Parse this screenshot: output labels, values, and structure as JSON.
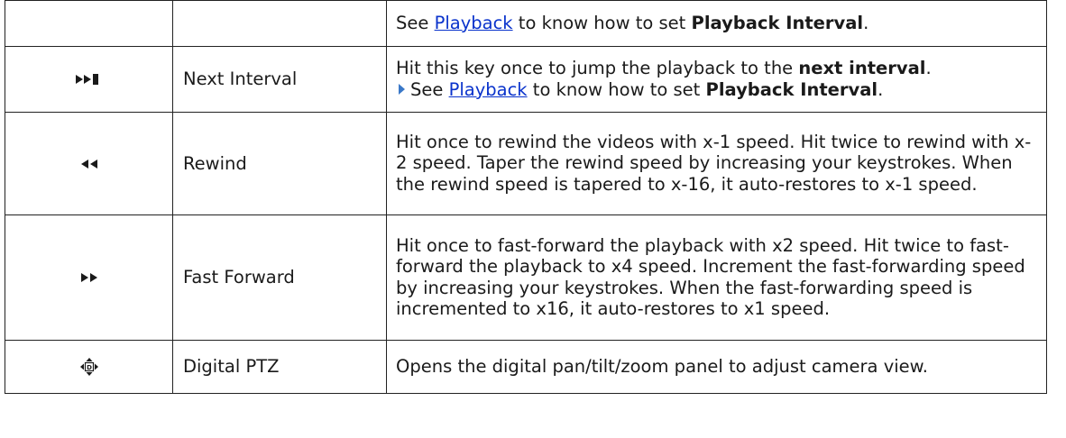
{
  "rows": [
    {
      "icon": "",
      "name": "",
      "desc": {
        "see": "See",
        "link": "Playback",
        "mid": "to know how to set",
        "bold": "Playback Interval",
        "end": "."
      }
    },
    {
      "icon": "next-interval-icon",
      "name": "Next Interval",
      "desc": {
        "line1": "Hit this key once to jump the playback to the",
        "line1_bold": "next interval",
        "line1_end": ".",
        "see": "See",
        "link": "Playback",
        "mid": "to know how to set",
        "bold": "Playback Interval",
        "end": "."
      }
    },
    {
      "icon": "rewind-icon",
      "name": "Rewind",
      "desc": "Hit once to rewind the videos with x-1 speed. Hit twice to rewind with x-2 speed. Taper the rewind speed by increasing your keystrokes. When the rewind speed is tapered to x-16, it auto-restores to x-1 speed."
    },
    {
      "icon": "fast-forward-icon",
      "name": "Fast Forward",
      "desc": "Hit once to fast-forward the playback with x2 speed. Hit twice to fast-forward the playback to x4 speed. Increment the fast-forwarding speed by increasing your keystrokes. When the fast-forwarding speed is incremented to x16, it auto-restores to x1 speed."
    },
    {
      "icon": "digital-ptz-icon",
      "name": "Digital PTZ",
      "desc": "Opens the digital pan/tilt/zoom panel to adjust camera view."
    }
  ],
  "colors": {
    "link": "#0a33cc",
    "border": "#222222",
    "arrow": "#3a78c8",
    "icon": "#1a1a1a"
  }
}
